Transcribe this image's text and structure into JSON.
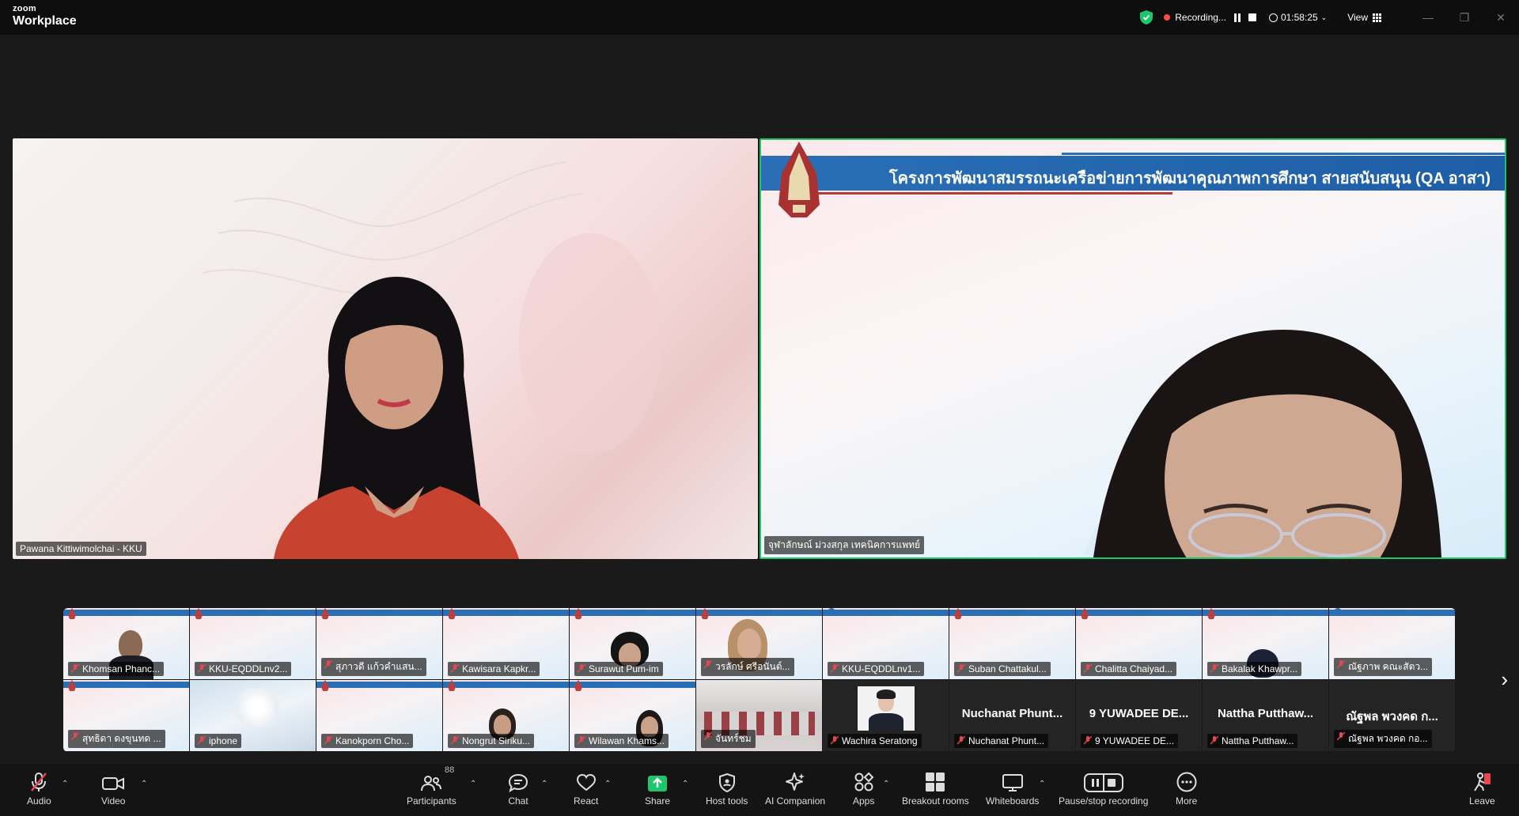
{
  "app": {
    "brand_small": "zoom",
    "brand_large": "Workplace"
  },
  "titlebar": {
    "recording_label": "Recording...",
    "timer": "01:58:25",
    "view_label": "View"
  },
  "speakers": [
    {
      "name": "Pawana Kittiwimolchai - KKU"
    },
    {
      "name": "จุฬาลักษณ์ ม่วงสกุล เทคนิคการแพทย์",
      "slide_title": "โครงการพัฒนาสมรรถนะเครือข่ายการพัฒนาคุณภาพการศึกษา สายสนับสนุน (QA อาสา)"
    }
  ],
  "gallery": {
    "row1": [
      {
        "name": "Khomsan Phanc..."
      },
      {
        "name": "KKU-EQDDLnv2..."
      },
      {
        "name": "สุภาวดี แก้วคำแสน..."
      },
      {
        "name": "Kawisara Kapkr..."
      },
      {
        "name": "Surawut Pum-im"
      },
      {
        "name": "วรลักษ์ ศรีอนันต์..."
      },
      {
        "name": "KKU-EQDDLnv1..."
      },
      {
        "name": "Suban Chattakul..."
      },
      {
        "name": "Chalitta Chaiyad..."
      },
      {
        "name": "Bakalak Khawpr..."
      },
      {
        "name": "ณัฐภาพ คณะสัตว..."
      }
    ],
    "row2": [
      {
        "name": "สุทธิดา ดงขุนทด ..."
      },
      {
        "name": "iphone"
      },
      {
        "name": "Kanokporn Cho..."
      },
      {
        "name": "Nongrut Siriku..."
      },
      {
        "name": "Wilawan Khams..."
      },
      {
        "name": "จันทร์ชม"
      },
      {
        "name": "Wachira Seratong"
      },
      {
        "name": "Nuchanat Phunt...",
        "display": "Nuchanat Phunt..."
      },
      {
        "name": "9 YUWADEE DE...",
        "display": "9 YUWADEE DE..."
      },
      {
        "name": "Nattha Putthaw...",
        "display": "Nattha Putthaw..."
      },
      {
        "name": "ณัฐพล พวงคด กอ...",
        "display": "ณัฐพล พวงคด ก..."
      }
    ]
  },
  "toolbar": {
    "audio": "Audio",
    "video": "Video",
    "participants": "Participants",
    "participants_count": "88",
    "chat": "Chat",
    "react": "React",
    "share": "Share",
    "host_tools": "Host tools",
    "ai_companion": "AI Companion",
    "apps": "Apps",
    "breakout_rooms": "Breakout rooms",
    "whiteboards": "Whiteboards",
    "pause_stop_recording": "Pause/stop recording",
    "more": "More",
    "leave": "Leave"
  },
  "colors": {
    "active_speaker": "#1ec56b",
    "recording": "#ff4b4b",
    "share_green": "#1ec56b",
    "muted_red": "#e5484d"
  }
}
